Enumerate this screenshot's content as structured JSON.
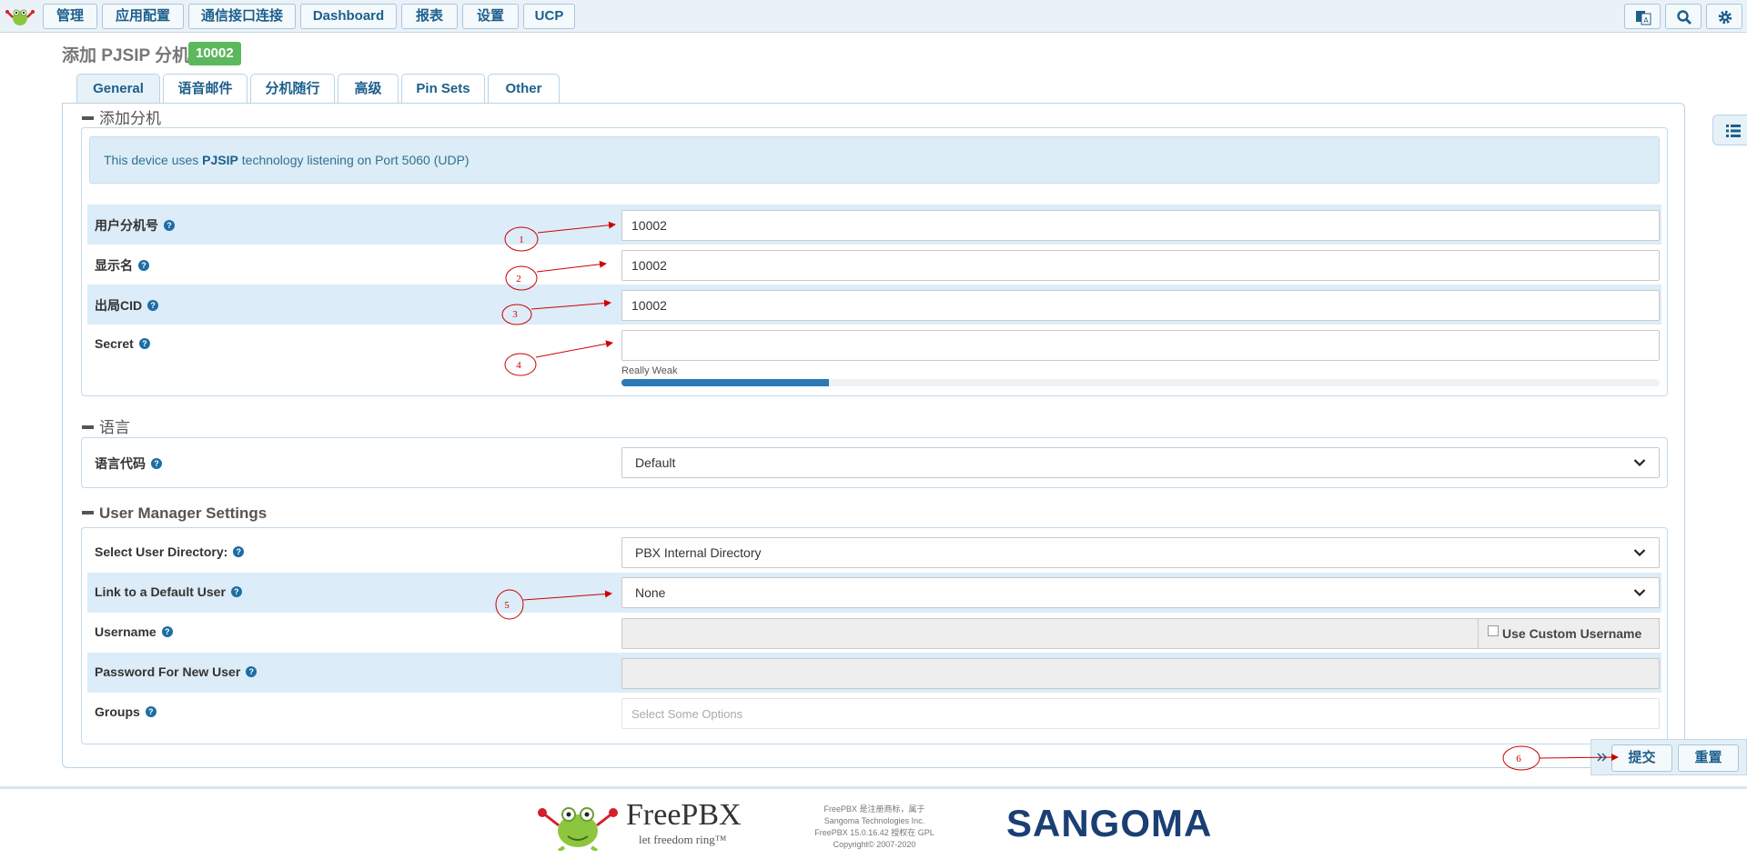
{
  "nav": {
    "items": [
      "管理",
      "应用配置",
      "通信接口连接",
      "Dashboard",
      "报表",
      "设置",
      "UCP"
    ]
  },
  "page": {
    "title": "添加 PJSIP 分机",
    "extension_badge": "10002"
  },
  "tabs": [
    "General",
    "语音邮件",
    "分机随行",
    "高级",
    "Pin Sets",
    "Other"
  ],
  "sections": {
    "add_extension": "添加分机",
    "language": "语言",
    "user_manager": "User Manager Settings"
  },
  "info": {
    "prefix": "This device uses ",
    "tech": "PJSIP",
    "suffix": " technology listening on Port 5060 (UDP)"
  },
  "fields": {
    "user_extension": {
      "label": "用户分机号",
      "value": "10002"
    },
    "display_name": {
      "label": "显示名",
      "value": "10002"
    },
    "outbound_cid": {
      "label": "出局CID",
      "value": "10002"
    },
    "secret": {
      "label": "Secret",
      "value": "",
      "strength_text": "Really Weak",
      "strength": 0.2
    },
    "language_code": {
      "label": "语言代码",
      "value": "Default"
    },
    "user_directory": {
      "label": "Select User Directory:",
      "value": "PBX Internal Directory"
    },
    "default_user": {
      "label": "Link to a Default User",
      "value": "None"
    },
    "username": {
      "label": "Username",
      "value": "",
      "custom_label": "Use Custom Username"
    },
    "password_new_user": {
      "label": "Password For New User",
      "value": ""
    },
    "groups": {
      "label": "Groups",
      "placeholder": "Select Some Options"
    }
  },
  "actions": {
    "submit": "提交",
    "reset": "重置"
  },
  "annotations": [
    "1",
    "2",
    "3",
    "4",
    "5",
    "6"
  ],
  "footer": {
    "brand": "FreePBX",
    "tagline": "let freedom ring™",
    "notice_lines": [
      "FreePBX 是注册商标，属于",
      "Sangoma Technologies Inc.",
      "FreePBX 15.0.16.42 授权在 GPL",
      "Copyright© 2007-2020"
    ],
    "sangoma": "SANGOMA"
  },
  "colors": {
    "accent": "#1c5f8c",
    "badge": "#5cb85c",
    "stripe": "#dcecf8",
    "annotation": "#cc0000"
  }
}
